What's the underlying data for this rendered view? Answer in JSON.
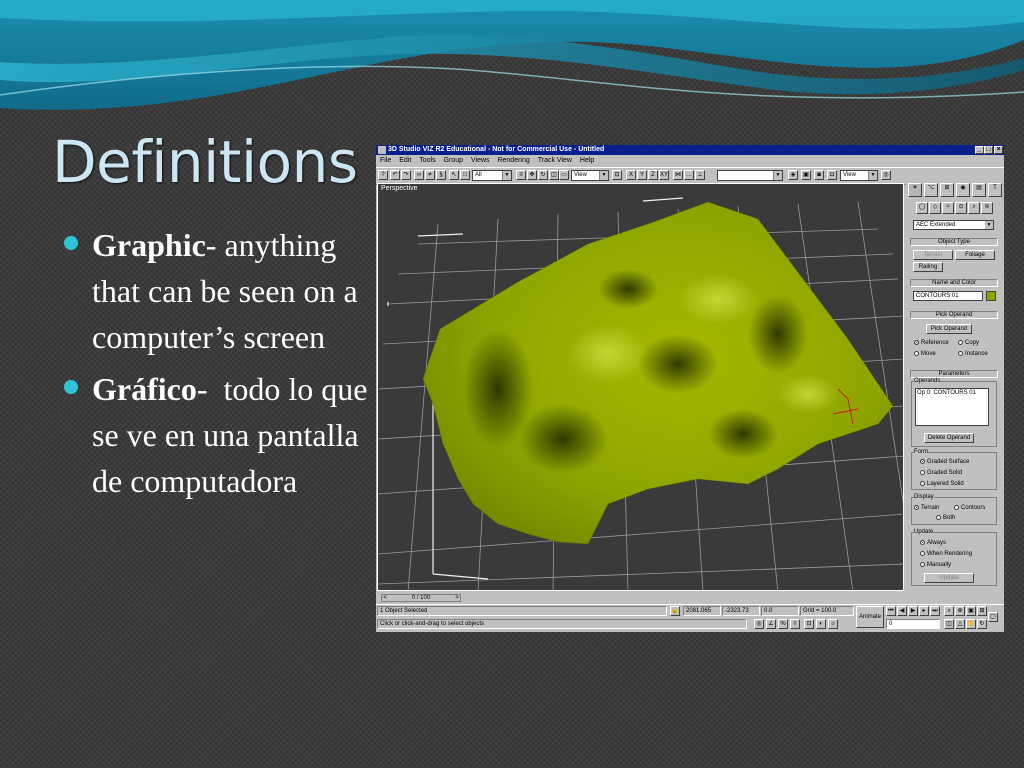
{
  "slide": {
    "title": "Definitions",
    "bullets": [
      {
        "term": "Graphic",
        "sep": "-",
        "text": " anything that can be seen on a computer’s screen"
      },
      {
        "term": "Gráfico",
        "sep": "-",
        "text": "  todo lo que se ve en una pantalla de computadora"
      }
    ]
  },
  "colors": {
    "accent": "#2ec4d8",
    "terrain": "#8fa400",
    "title_bar": "#0a1e8c"
  },
  "app": {
    "title": "3D Studio VIZ R2 Educational - Not for Commercial Use - Untitled",
    "menu": [
      "File",
      "Edit",
      "Tools",
      "Group",
      "Views",
      "Rendering",
      "Track View",
      "Help"
    ],
    "toolbar": {
      "selection_filter": "All",
      "ref_coord": "View",
      "named_selection": "",
      "render_type": "View"
    },
    "viewport": {
      "label": "Perspective"
    },
    "command_panel": {
      "category": "AEC Extended",
      "object_type": {
        "header": "Object Type",
        "buttons": [
          "Terrain",
          "Foliage",
          "Railing"
        ]
      },
      "name_color": {
        "header": "Name and Color",
        "name": "CONTOURS 01"
      },
      "pick_operand": {
        "header": "Pick Operand",
        "button": "Pick Operand",
        "options": [
          "Reference",
          "Copy",
          "Move",
          "Instance"
        ],
        "selected": "Reference"
      },
      "parameters": {
        "header": "Parameters",
        "operands_label": "Operands",
        "operands": [
          "Op 0: CONTOURS 01"
        ],
        "delete_button": "Delete Operand",
        "form": {
          "label": "Form",
          "options": [
            "Graded Surface",
            "Graded Solid",
            "Layered Solid"
          ],
          "selected": "Graded Surface"
        },
        "display": {
          "label": "Display",
          "options": [
            "Terrain",
            "Contours",
            "Both"
          ],
          "selected": "Terrain"
        },
        "update": {
          "label": "Update",
          "options": [
            "Always",
            "When Rendering",
            "Manually"
          ],
          "selected": "Always",
          "button": "Update"
        }
      }
    },
    "timebar": {
      "frame": "0 / 100"
    },
    "status": {
      "selection": "1 Object Selected",
      "prompt": "Click or click-and-drag to select objects",
      "x": "2081.065",
      "y": "-2323.73",
      "z": "0.0",
      "grid": "Grid = 100.0",
      "animate": "Animate",
      "frame_field": "0"
    }
  }
}
